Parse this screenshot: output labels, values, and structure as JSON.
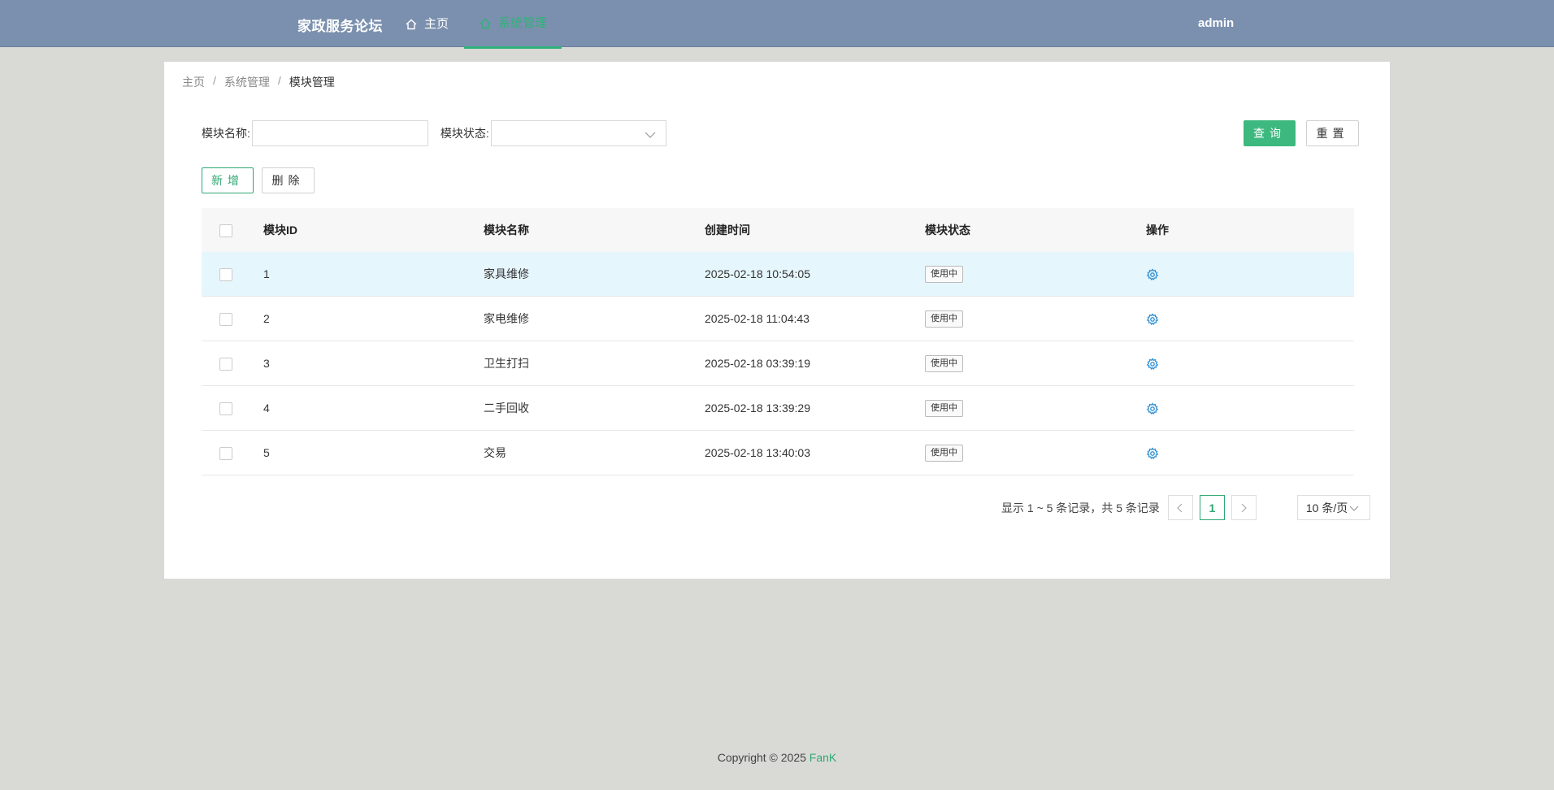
{
  "header": {
    "brand": "家政服务论坛",
    "nav": [
      {
        "label": "主页",
        "icon": "home-icon"
      },
      {
        "label": "系统管理",
        "icon": "home-icon",
        "active": true
      }
    ],
    "user": "admin",
    "colors": {
      "bar": "#7b90ae",
      "accent": "#2fb27a"
    }
  },
  "breadcrumb": {
    "items": [
      "主页",
      "系统管理",
      "模块管理"
    ],
    "separator": "/"
  },
  "search": {
    "name_label": "模块名称:",
    "name_value": "",
    "status_label": "模块状态:",
    "status_value": "",
    "query_label": "查询",
    "reset_label": "重置"
  },
  "actions": {
    "add_label": "新增",
    "delete_label": "删除"
  },
  "table": {
    "columns": [
      "模块ID",
      "模块名称",
      "创建时间",
      "模块状态",
      "操作"
    ],
    "rows": [
      {
        "id": "1",
        "name": "家具维修",
        "created": "2025-02-18 10:54:05",
        "status": "使用中"
      },
      {
        "id": "2",
        "name": "家电维修",
        "created": "2025-02-18 11:04:43",
        "status": "使用中"
      },
      {
        "id": "3",
        "name": "卫生打扫",
        "created": "2025-02-18 03:39:19",
        "status": "使用中"
      },
      {
        "id": "4",
        "name": "二手回收",
        "created": "2025-02-18 13:39:29",
        "status": "使用中"
      },
      {
        "id": "5",
        "name": "交易",
        "created": "2025-02-18 13:40:03",
        "status": "使用中"
      }
    ]
  },
  "pager": {
    "summary": "显示 1 ~ 5 条记录，共 5 条记录",
    "current_page": "1",
    "page_size": "10 条/页"
  },
  "footer": {
    "copyright": "Copyright © 2025 ",
    "author": "FanK"
  }
}
